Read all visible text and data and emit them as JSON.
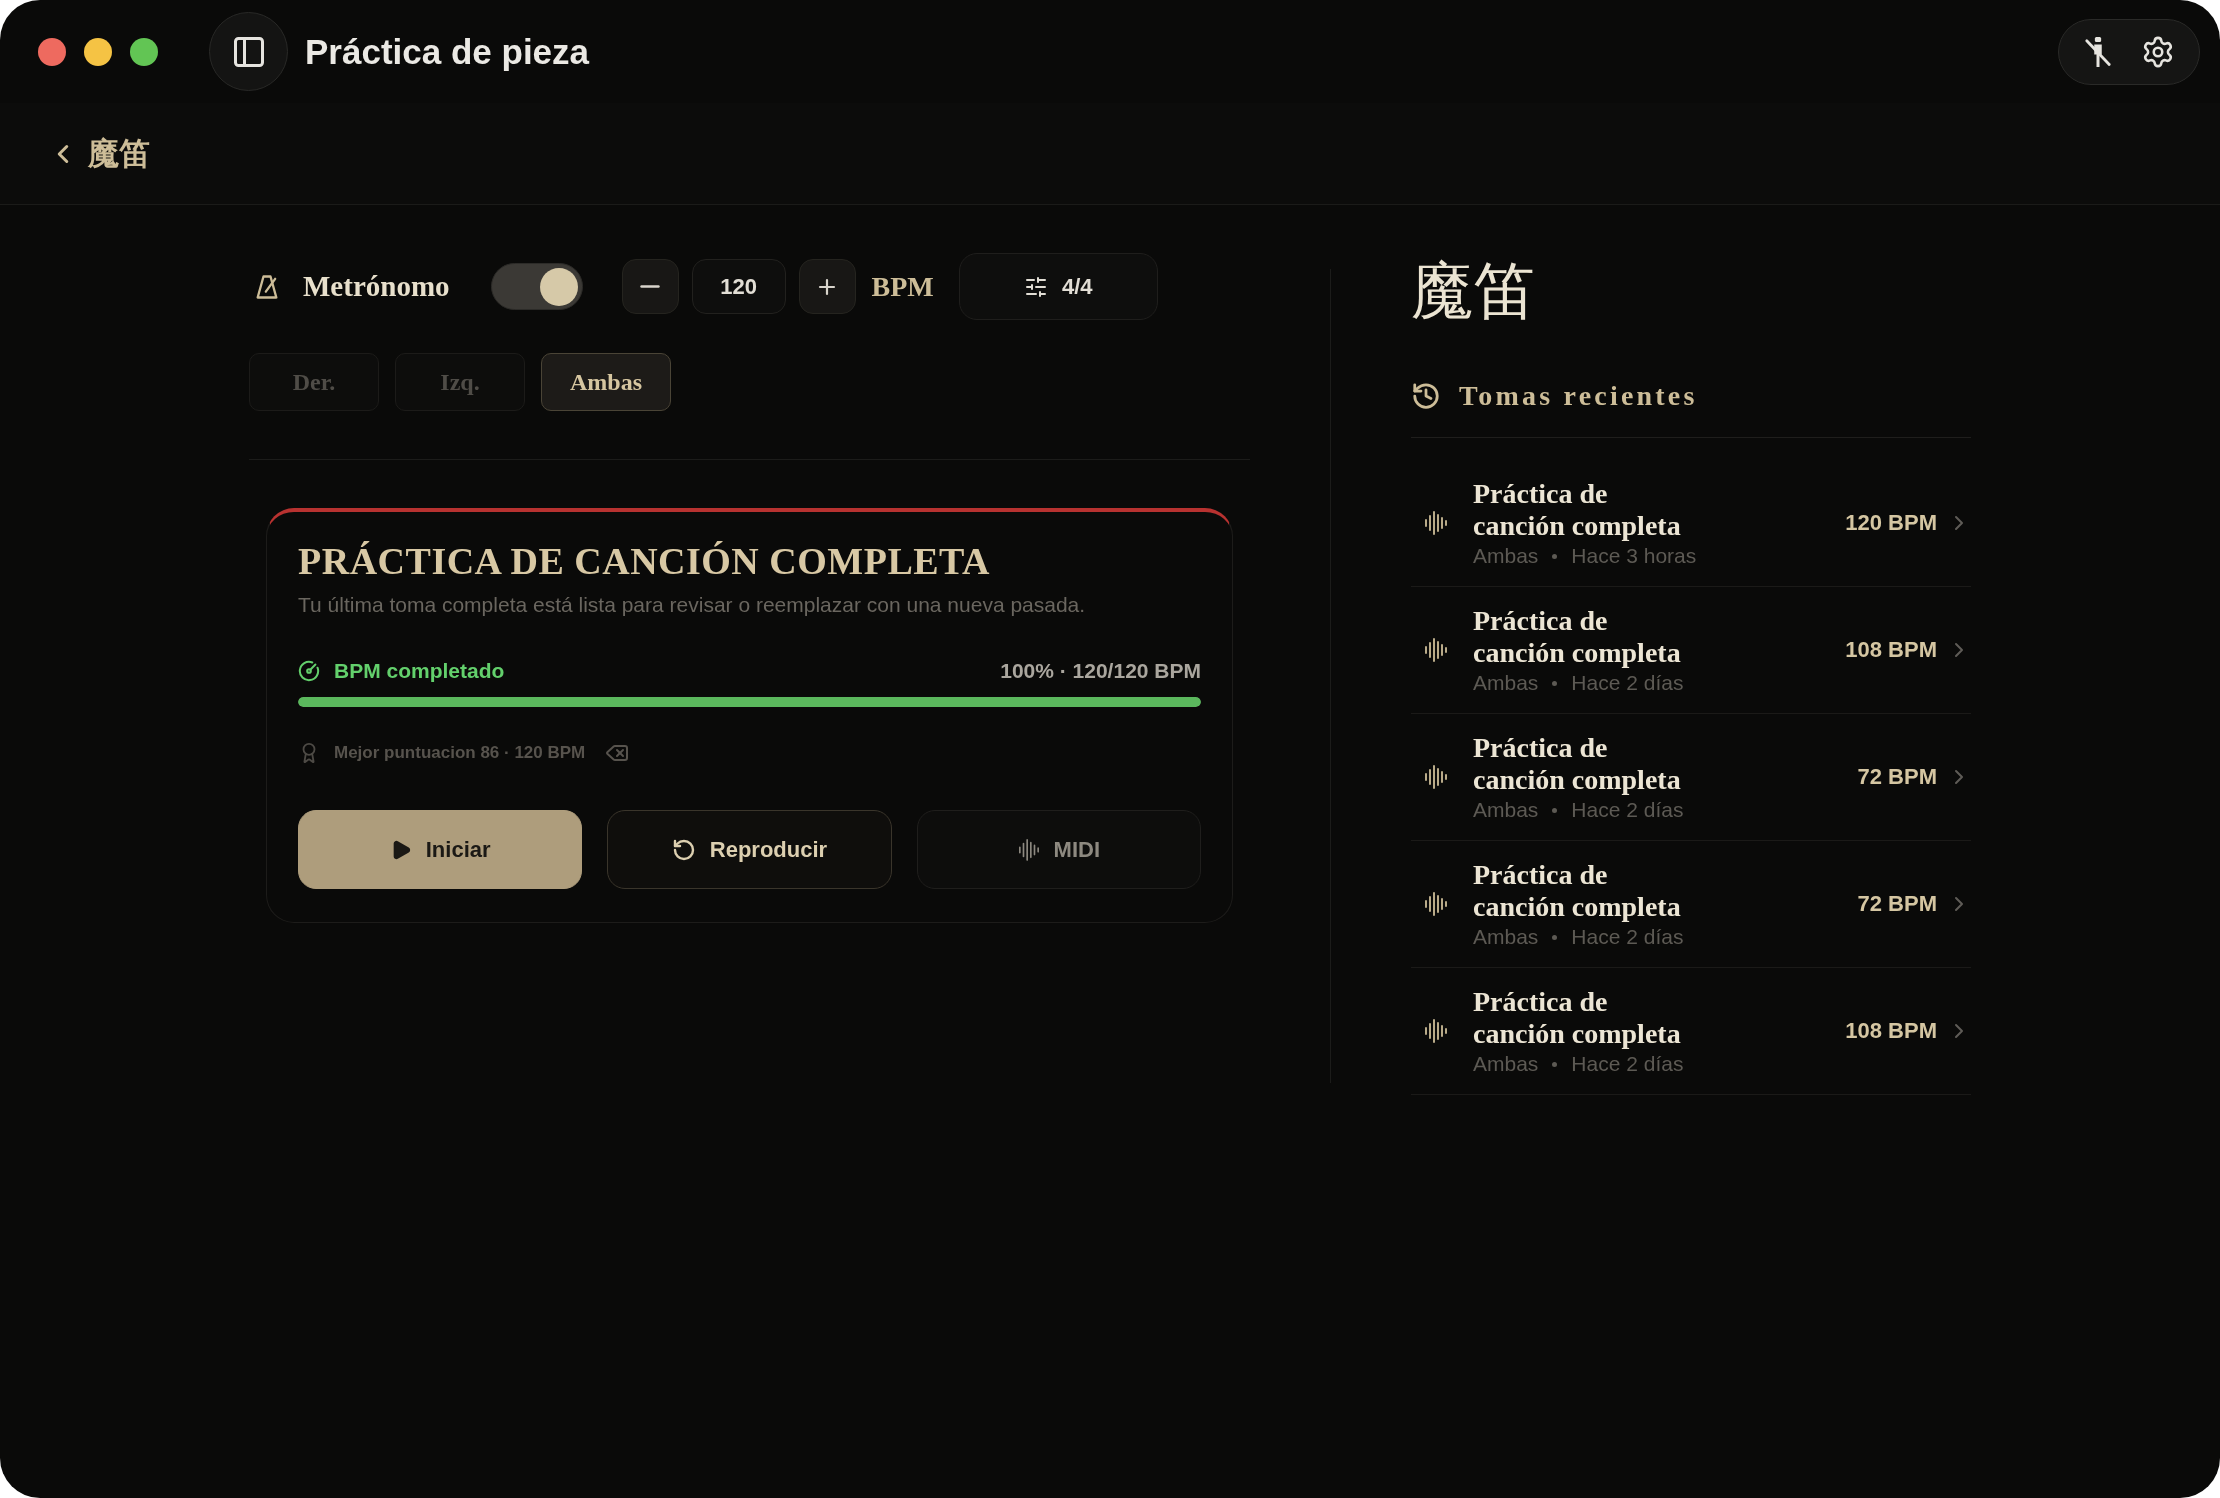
{
  "window": {
    "title": "Práctica de pieza"
  },
  "back": {
    "label": "魔笛"
  },
  "metronome": {
    "label": "Metrónomo",
    "on": true,
    "bpm": "120",
    "unit": "BPM",
    "time_signature": "4/4"
  },
  "hands": [
    {
      "label": "Der.",
      "selected": false
    },
    {
      "label": "Izq.",
      "selected": false
    },
    {
      "label": "Ambas",
      "selected": true
    }
  ],
  "card": {
    "title": "PRÁCTICA DE CANCIÓN COMPLETA",
    "description": "Tu última toma completa está lista para revisar o reemplazar con una nueva pasada.",
    "status": "BPM completado",
    "summary": "100% · 120/120 BPM",
    "level": 1,
    "best": "Mejor puntuacion 86 · 120 BPM",
    "actions": [
      {
        "kind": "primary",
        "label": "Iniciar"
      },
      {
        "kind": "secondary",
        "label": "Reproducir"
      },
      {
        "kind": "muted",
        "label": "MIDI"
      }
    ]
  },
  "piece": {
    "title": "魔笛"
  },
  "recent": {
    "title": "Tomas recientes",
    "takes": [
      {
        "title": "Práctica de canción completa",
        "hand": "Ambas",
        "time": "Hace 3 horas",
        "bpm": "120 BPM"
      },
      {
        "title": "Práctica de canción completa",
        "hand": "Ambas",
        "time": "Hace 2 días",
        "bpm": "108 BPM"
      },
      {
        "title": "Práctica de canción completa",
        "hand": "Ambas",
        "time": "Hace 2 días",
        "bpm": "72 BPM"
      },
      {
        "title": "Práctica de canción completa",
        "hand": "Ambas",
        "time": "Hace 2 días",
        "bpm": "72 BPM"
      },
      {
        "title": "Práctica de canción completa",
        "hand": "Ambas",
        "time": "Hace 2 días",
        "bpm": "108 BPM"
      }
    ]
  }
}
